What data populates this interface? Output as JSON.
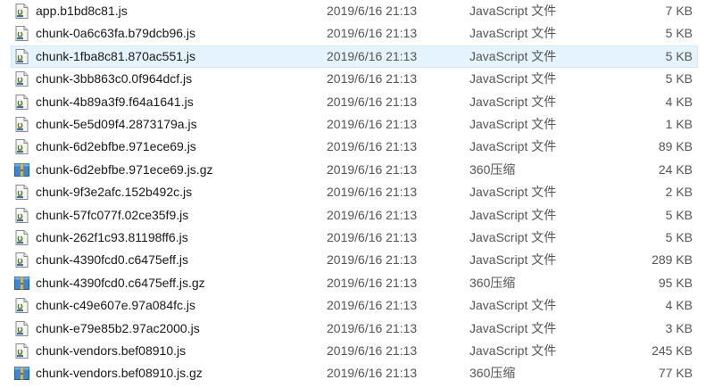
{
  "files": [
    {
      "name": "app.b1bd8c81.js",
      "date": "2019/6/16 21:13",
      "type": "JavaScript 文件",
      "size": "7 KB",
      "icon": "javascript-file-icon"
    },
    {
      "name": "chunk-0a6c63fa.b79dcb96.js",
      "date": "2019/6/16 21:13",
      "type": "JavaScript 文件",
      "size": "5 KB",
      "icon": "javascript-file-icon"
    },
    {
      "name": "chunk-1fba8c81.870ac551.js",
      "date": "2019/6/16 21:13",
      "type": "JavaScript 文件",
      "size": "5 KB",
      "icon": "javascript-file-icon",
      "selected": true
    },
    {
      "name": "chunk-3bb863c0.0f964dcf.js",
      "date": "2019/6/16 21:13",
      "type": "JavaScript 文件",
      "size": "5 KB",
      "icon": "javascript-file-icon"
    },
    {
      "name": "chunk-4b89a3f9.f64a1641.js",
      "date": "2019/6/16 21:13",
      "type": "JavaScript 文件",
      "size": "4 KB",
      "icon": "javascript-file-icon"
    },
    {
      "name": "chunk-5e5d09f4.2873179a.js",
      "date": "2019/6/16 21:13",
      "type": "JavaScript 文件",
      "size": "1 KB",
      "icon": "javascript-file-icon"
    },
    {
      "name": "chunk-6d2ebfbe.971ece69.js",
      "date": "2019/6/16 21:13",
      "type": "JavaScript 文件",
      "size": "89 KB",
      "icon": "javascript-file-icon"
    },
    {
      "name": "chunk-6d2ebfbe.971ece69.js.gz",
      "date": "2019/6/16 21:13",
      "type": "360压缩",
      "size": "24 KB",
      "icon": "archive-file-icon"
    },
    {
      "name": "chunk-9f3e2afc.152b492c.js",
      "date": "2019/6/16 21:13",
      "type": "JavaScript 文件",
      "size": "2 KB",
      "icon": "javascript-file-icon"
    },
    {
      "name": "chunk-57fc077f.02ce35f9.js",
      "date": "2019/6/16 21:13",
      "type": "JavaScript 文件",
      "size": "5 KB",
      "icon": "javascript-file-icon"
    },
    {
      "name": "chunk-262f1c93.81198ff6.js",
      "date": "2019/6/16 21:13",
      "type": "JavaScript 文件",
      "size": "5 KB",
      "icon": "javascript-file-icon"
    },
    {
      "name": "chunk-4390fcd0.c6475eff.js",
      "date": "2019/6/16 21:13",
      "type": "JavaScript 文件",
      "size": "289 KB",
      "icon": "javascript-file-icon"
    },
    {
      "name": "chunk-4390fcd0.c6475eff.js.gz",
      "date": "2019/6/16 21:13",
      "type": "360压缩",
      "size": "95 KB",
      "icon": "archive-file-icon"
    },
    {
      "name": "chunk-c49e607e.97a084fc.js",
      "date": "2019/6/16 21:13",
      "type": "JavaScript 文件",
      "size": "4 KB",
      "icon": "javascript-file-icon"
    },
    {
      "name": "chunk-e79e85b2.97ac2000.js",
      "date": "2019/6/16 21:13",
      "type": "JavaScript 文件",
      "size": "3 KB",
      "icon": "javascript-file-icon"
    },
    {
      "name": "chunk-vendors.bef08910.js",
      "date": "2019/6/16 21:13",
      "type": "JavaScript 文件",
      "size": "245 KB",
      "icon": "javascript-file-icon"
    },
    {
      "name": "chunk-vendors.bef08910.js.gz",
      "date": "2019/6/16 21:13",
      "type": "360压缩",
      "size": "77 KB",
      "icon": "archive-file-icon"
    }
  ],
  "colors": {
    "selection_bg": "#e5f3ff",
    "selection_border": "#cce8ff",
    "meta_text": "#555555"
  }
}
